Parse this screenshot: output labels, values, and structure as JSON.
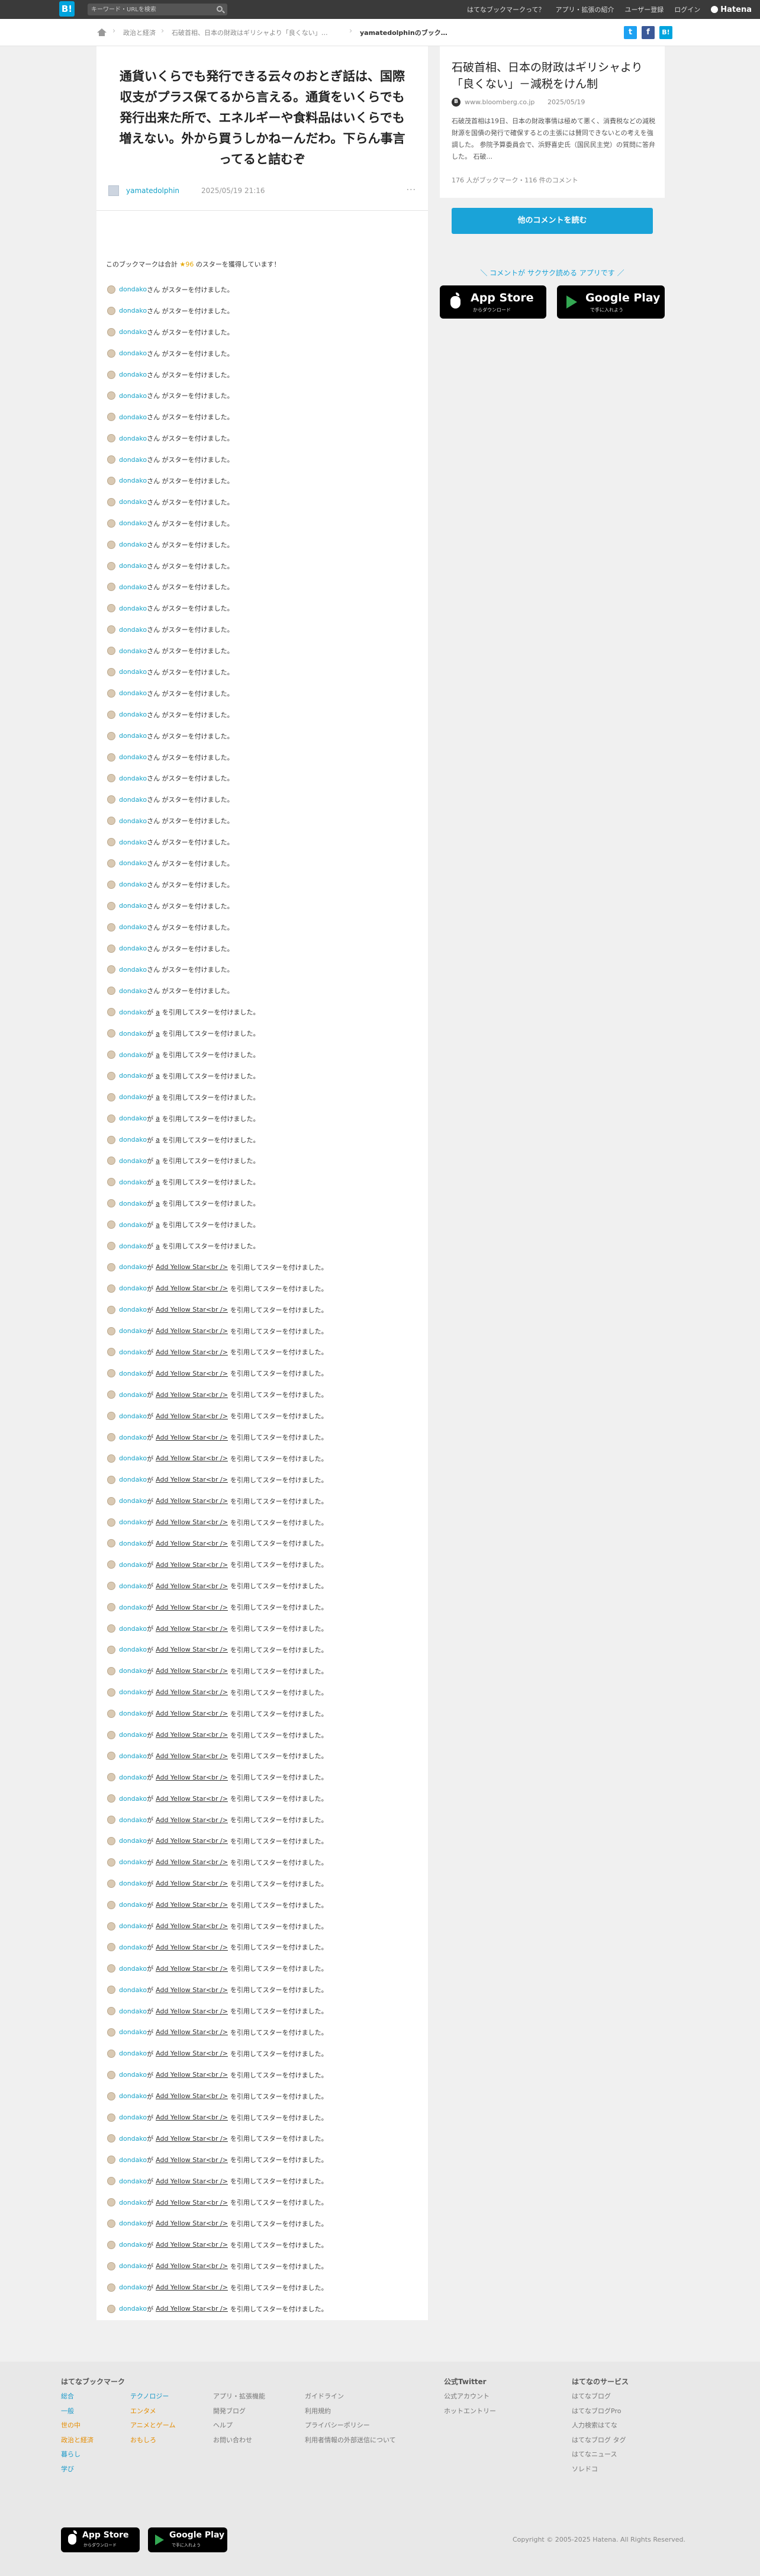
{
  "topbar": {
    "logo": "B!",
    "search_placeholder": "キーワード・URLを検索",
    "nav": [
      "はてなブックマークって？",
      "アプリ・拡張の紹介",
      "ユーザー登録",
      "ログイン"
    ],
    "brand": "Hatena"
  },
  "breadcrumb": {
    "items": [
      "政治と経済",
      "石破首相、日本の財政はギリシャより「良くない」…"
    ],
    "current": "yamatedolphinのブック…"
  },
  "share": {
    "twitter": "t",
    "facebook": "f",
    "hatebu": "B!"
  },
  "bookmark": {
    "comment": "通貨いくらでも発行できる云々のおとぎ話は、国際収支がプラス保てる​から言える。通貨をいくらでも発行出来た所で、エネルギーや食料品はいくらでも増えない。外から買うしかねーんだわ。下らん事言ってると詰むぞ",
    "user": "yamatedolphin",
    "date": "2025/05/19 21:16",
    "more": "···"
  },
  "stars": {
    "summary_prefix": "このブックマークは合計",
    "summary_count": "★96",
    "summary_suffix": "のスターを獲得しています！",
    "user": "dondako",
    "simple_text": "さん がスターを付けました。",
    "tag_mid": "が",
    "tag_plain": "a",
    "tag_long": "Add Yellow Star<br />",
    "tag_suffix": "を引用してスターを付けました。"
  },
  "entry": {
    "title": "石破首相、日本の財政はギリシャより「良くない」－減税をけん制",
    "favicon": "B",
    "domain": "www.bloomberg.co.jp",
    "date": "2025/05/19",
    "summary": "石破茂首相は19日、日本の財政事情は極めて悪く、消費税などの減税財源を国債の発行で確保するとの主張には賛同できないとの考えを強調した。 参院予算委員会で、浜野喜史氏（国民民主党）の質問に答弁した。 石破...",
    "counts": "176 人がブックマーク・116 件のコメント"
  },
  "sidebar": {
    "read_button": "他のコメントを読む",
    "promo": "＼ コメントが サクサク読める アプリです ／"
  },
  "stores": {
    "apple_big": "App Store",
    "apple_small": "からダウンロード",
    "google_big": "Google Play",
    "google_small": "で手に入れよう"
  },
  "footer": {
    "bookmark_head": "はてなブックマーク",
    "twitter_head": "公式Twitter",
    "services_head": "はてなのサービス",
    "col1": [
      "総合",
      "一般",
      "世の中",
      "政治と経済",
      "暮らし",
      "学び"
    ],
    "col2": [
      "テクノロジー",
      "エンタメ",
      "アニメとゲーム",
      "おもしろ"
    ],
    "col3": [
      "アプリ・拡張機能",
      "開発ブログ",
      "ヘルプ",
      "お問い合わせ"
    ],
    "col4": [
      "ガイドライン",
      "利用規約",
      "プライバシーポリシー",
      "利用者情報の外部送信について"
    ],
    "col5": [
      "公式アカウント",
      "ホットエントリー"
    ],
    "col6": [
      "はてなブログ",
      "はてなブログPro",
      "人力検索はてな",
      "はてなブログ タグ",
      "はてなニュース",
      "ソレドコ"
    ],
    "copyright": "Copyright © 2005-2025 Hatena. All Rights Reserved."
  },
  "colors": {
    "accent": "#1aa3d8",
    "topbar": "#3a3a3a",
    "star": "#e6a700",
    "link": "#17a2c8"
  }
}
